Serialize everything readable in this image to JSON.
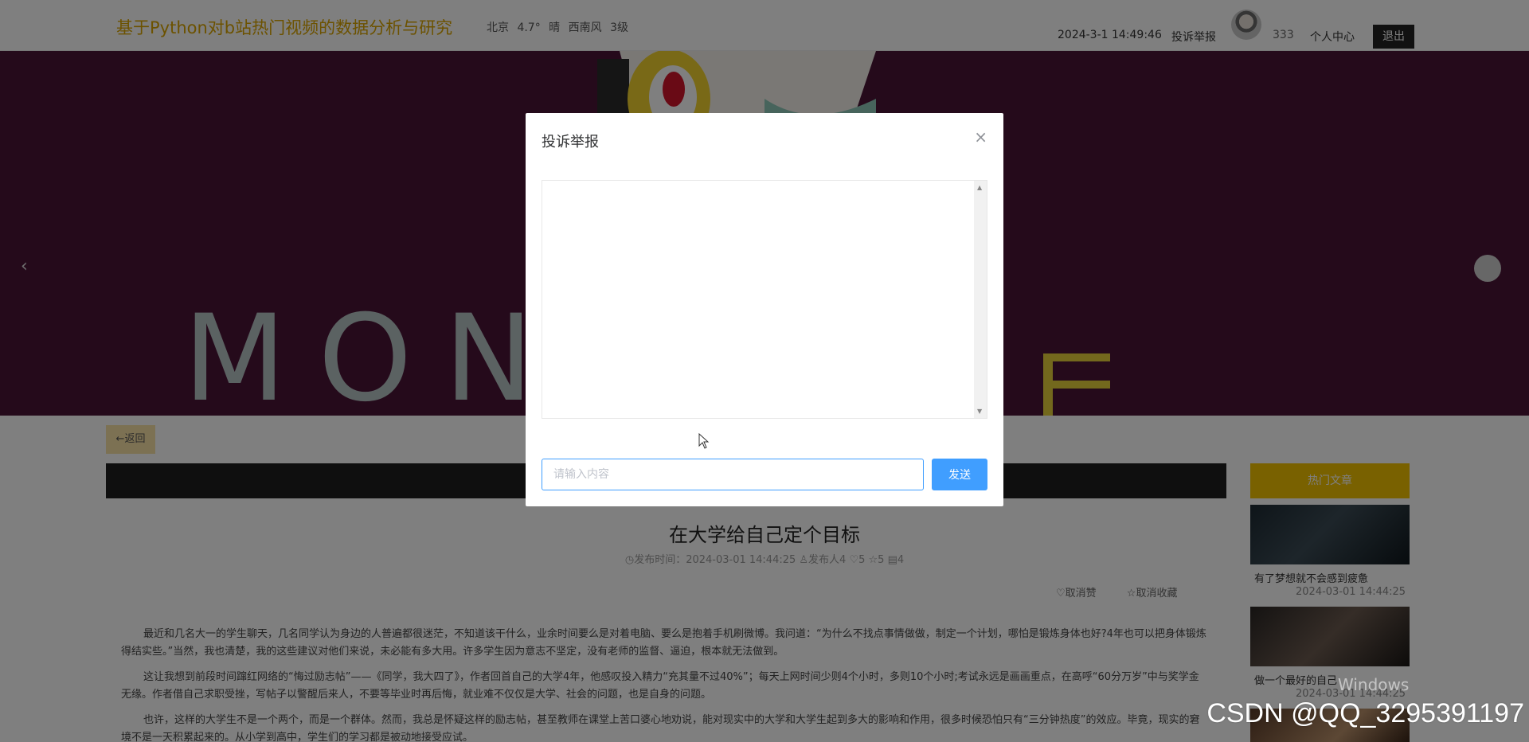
{
  "header": {
    "site_title": "基于Python对b站热门视频的数据分析与研究",
    "weather": "北京  4.7°  晴  西南风  3级",
    "datetime": "2024-3-1 14:49:46",
    "report_link": "投诉举报",
    "username": "333",
    "profile_link": "个人中心",
    "logout_label": "退出"
  },
  "banner": {
    "text": "MON"
  },
  "content": {
    "back_label": "←返回",
    "article_title": "在大学给自己定个目标",
    "meta": "◷发布时间：2024-03-01 14:44:25   ♙发布人4  ♡5  ☆5  ▤4",
    "unlike_label": "♡取消赞",
    "uncollect_label": "☆取消收藏",
    "paragraphs": [
      "最近和几名大一的学生聊天，几名同学认为身边的人普遍都很迷茫，不知道该干什么，业余时间要么是对着电脑、要么是抱着手机刷微博。我问道：“为什么不找点事情做做，制定一个计划，哪怕是锻炼身体也好?4年也可以把身体锻炼得结实些。”当然，我也清楚，我的这些建议对他们来说，未必能有多大用。许多学生因为意志不坚定，没有老师的监督、逼迫，根本就无法做到。",
      "这让我想到前段时间蹿红网络的“悔过励志帖”——《同学，我大四了》，作者回首自己的大学4年，他感叹投入精力“充其量不过40%”；每天上网时间少则4个小时，多则10个小时;考试永远是画画重点，在高呼“60分万岁”中与奖学金无缘。作者借自己求职受挫，写帖子以警醒后来人，不要等毕业时再后悔，就业难不仅仅是大学、社会的问题，也是自身的问题。",
      "也许，这样的大学生不是一个两个，而是一个群体。然而，我总是怀疑这样的励志帖，甚至教师在课堂上苦口婆心地劝说，能对现实中的大学和大学生起到多大的影响和作用，很多时候恐怕只有“三分钟热度”的效应。毕竟，现实的窘境不是一天积累起来的。从小学到高中，学生们的学习都是被动地接受应试。"
    ],
    "hot_header": "热门文章",
    "hot_items": [
      {
        "caption": "有了梦想就不会感到疲惫",
        "date": "2024-03-01 14:44:25"
      },
      {
        "caption": "做一个最好的自己",
        "date": "2024-03-01 14:44:25"
      }
    ]
  },
  "modal": {
    "title": "投诉举报",
    "input_placeholder": "请输入内容",
    "send_label": "发送"
  },
  "watermarks": {
    "os": "Windows",
    "csdn": "CSDN @QQ_3295391197"
  }
}
